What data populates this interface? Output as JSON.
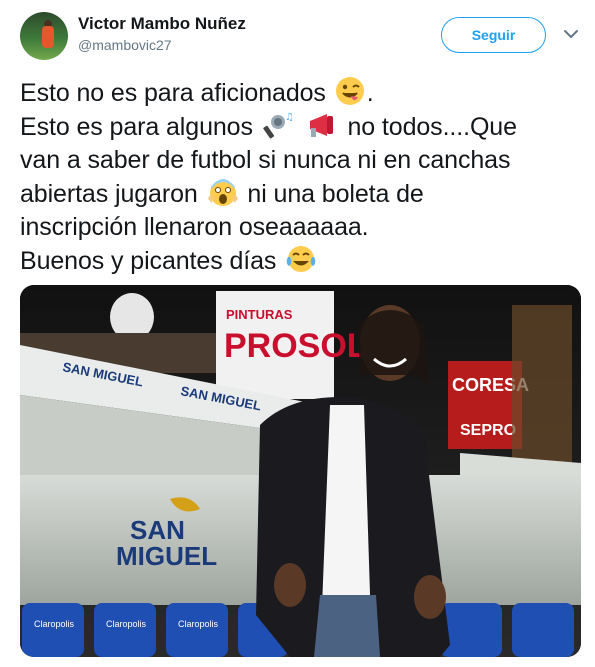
{
  "author": {
    "display_name": "Victor Mambo Nuñez",
    "handle": "@mambovic27"
  },
  "actions": {
    "follow_label": "Seguir"
  },
  "icons": {
    "menu": "chevron-down-icon",
    "avatar": "avatar",
    "emoji_1": "winking-face-tongue-emoji",
    "emoji_2": "microphone-music-emoji",
    "emoji_3": "megaphone-emoji",
    "emoji_4": "screaming-face-emoji",
    "emoji_5": "tears-of-joy-emoji"
  },
  "tweet": {
    "line1": "Esto no es para aficionados",
    "line1_end": ".",
    "line2a": "Esto es para algunos",
    "line2b": "no todos....Que",
    "line3": "van a saber de futbol si nunca ni en canchas",
    "line4a": "abiertas jugaron",
    "line4b": "ni una boleta de",
    "line5": "inscripción llenaron oseaaaaaa.",
    "line6": "Buenos y picantes días"
  },
  "photo": {
    "sign_brand_1": "SAN",
    "sign_brand_2": "MIGUEL",
    "banner_1": "PINTURAS",
    "banner_2": "PROSOL",
    "banner_3": "CORESA",
    "banner_4": "SEPRO",
    "seat_brand": "Claropolis",
    "bench_strip": "SAN MIGUEL"
  },
  "colors": {
    "accent": "#1da1f2",
    "text": "#14171a",
    "secondary": "#657786"
  }
}
